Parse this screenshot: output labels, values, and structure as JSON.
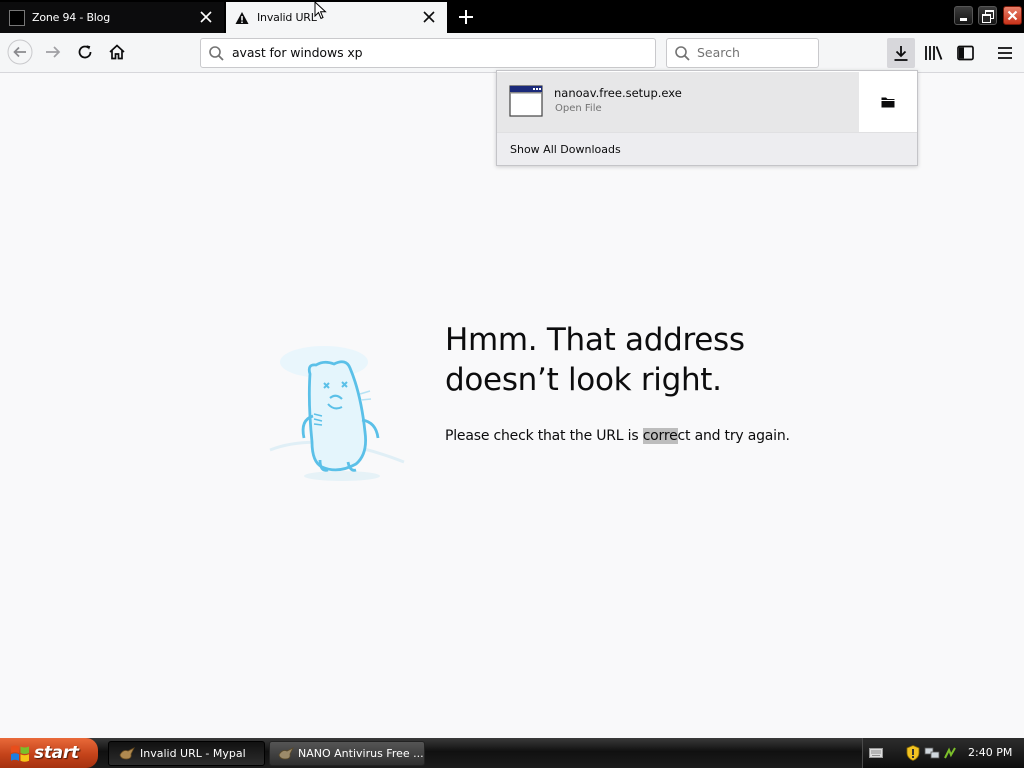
{
  "browser": {
    "tabs": [
      {
        "label": "Zone 94 - Blog",
        "active": false,
        "icon": "black-square-favicon"
      },
      {
        "label": "Invalid URL",
        "active": true,
        "icon": "warning-triangle-icon"
      }
    ],
    "url": "avast for windows xp",
    "search_placeholder": "Search"
  },
  "downloads_panel": {
    "filename": "nanoav.free.setup.exe",
    "status": "Open File",
    "show_all": "Show All Downloads"
  },
  "error_page": {
    "title": "Hmm. That address\ndoesn’t look right.",
    "body_before": "Please check that the URL is ",
    "body_highlight": "corre",
    "body_after": "ct and try again."
  },
  "taskbar": {
    "start_label": "start",
    "tasks": [
      {
        "label": "Invalid URL - Mypal",
        "active": true
      },
      {
        "label": "NANO Antivirus Free ...",
        "active": false
      }
    ],
    "clock": "2:40 PM"
  },
  "colors": {
    "page_bg": "#f9f9fa",
    "tab_active_bg": "#f5f6f7",
    "start_orange": "#d4531f",
    "illustration_blue": "#5bc0e8"
  }
}
